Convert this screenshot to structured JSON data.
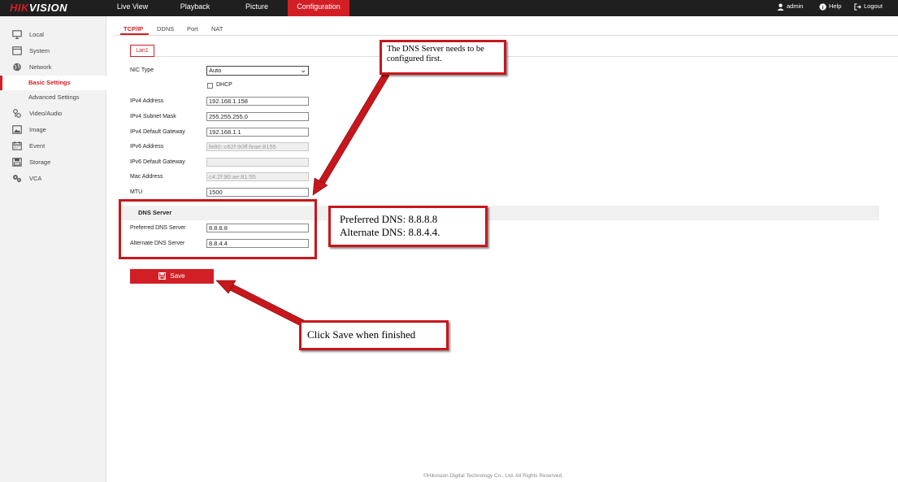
{
  "header": {
    "logo_text": "HIKVISION",
    "nav": [
      "Live View",
      "Playback",
      "Picture",
      "Configuration"
    ],
    "active_nav": "Configuration",
    "user": "admin",
    "help": "Help",
    "logout": "Logout"
  },
  "sidebar": {
    "items": [
      {
        "label": "Local",
        "icon": "monitor-icon"
      },
      {
        "label": "System",
        "icon": "system-icon"
      },
      {
        "label": "Network",
        "icon": "globe-icon"
      },
      {
        "label": "Basic Settings",
        "active": true
      },
      {
        "label": "Advanced Settings"
      },
      {
        "label": "Video/Audio",
        "icon": "video-audio-icon"
      },
      {
        "label": "Image",
        "icon": "image-icon"
      },
      {
        "label": "Event",
        "icon": "calendar-icon"
      },
      {
        "label": "Storage",
        "icon": "storage-icon"
      },
      {
        "label": "VCA",
        "icon": "vca-icon"
      }
    ]
  },
  "tabs": [
    "TCP/IP",
    "DDNS",
    "Port",
    "NAT"
  ],
  "active_tab": "TCP/IP",
  "lan_tab": "Lan1",
  "form": {
    "nic_type_label": "NIC Type",
    "nic_type_value": "Auto",
    "dhcp_label": "DHCP",
    "dhcp_checked": false,
    "ipv4_address_label": "IPv4 Address",
    "ipv4_address": "192.168.1.158",
    "ipv4_mask_label": "IPv4 Subnet Mask",
    "ipv4_mask": "255.255.255.0",
    "ipv4_gateway_label": "IPv4 Default Gateway",
    "ipv4_gateway": "192.168.1.1",
    "ipv6_address_label": "IPv6 Address",
    "ipv6_address": "fe80::c62f:90ff:feae:8155",
    "ipv6_gateway_label": "IPv6 Default Gateway",
    "ipv6_gateway": "",
    "mac_label": "Mac Address",
    "mac": "c4:2f:90:ae:81:55",
    "mtu_label": "MTU",
    "mtu": "1500",
    "dns_section_title": "DNS Server",
    "preferred_dns_label": "Preferred DNS Server",
    "preferred_dns": "8.8.8.8",
    "alternate_dns_label": "Alternate DNS Server",
    "alternate_dns": "8.8.4.4"
  },
  "save_label": "Save",
  "footer": "©Hikvision Digital Technology Co., Ltd. All Rights Reserved.",
  "annotations": {
    "dns_note_line1": "The DNS Server needs to be",
    "dns_note_line2": "configured first.",
    "values_line1": "Preferred DNS: 8.8.8.8",
    "values_line2": "Alternate DNS: 8.8.4.4.",
    "save_note": "Click Save when finished"
  },
  "colors": {
    "brand_red": "#d21f26",
    "topbar": "#1f1f1f",
    "sidebar_bg": "#f2f2f2"
  }
}
